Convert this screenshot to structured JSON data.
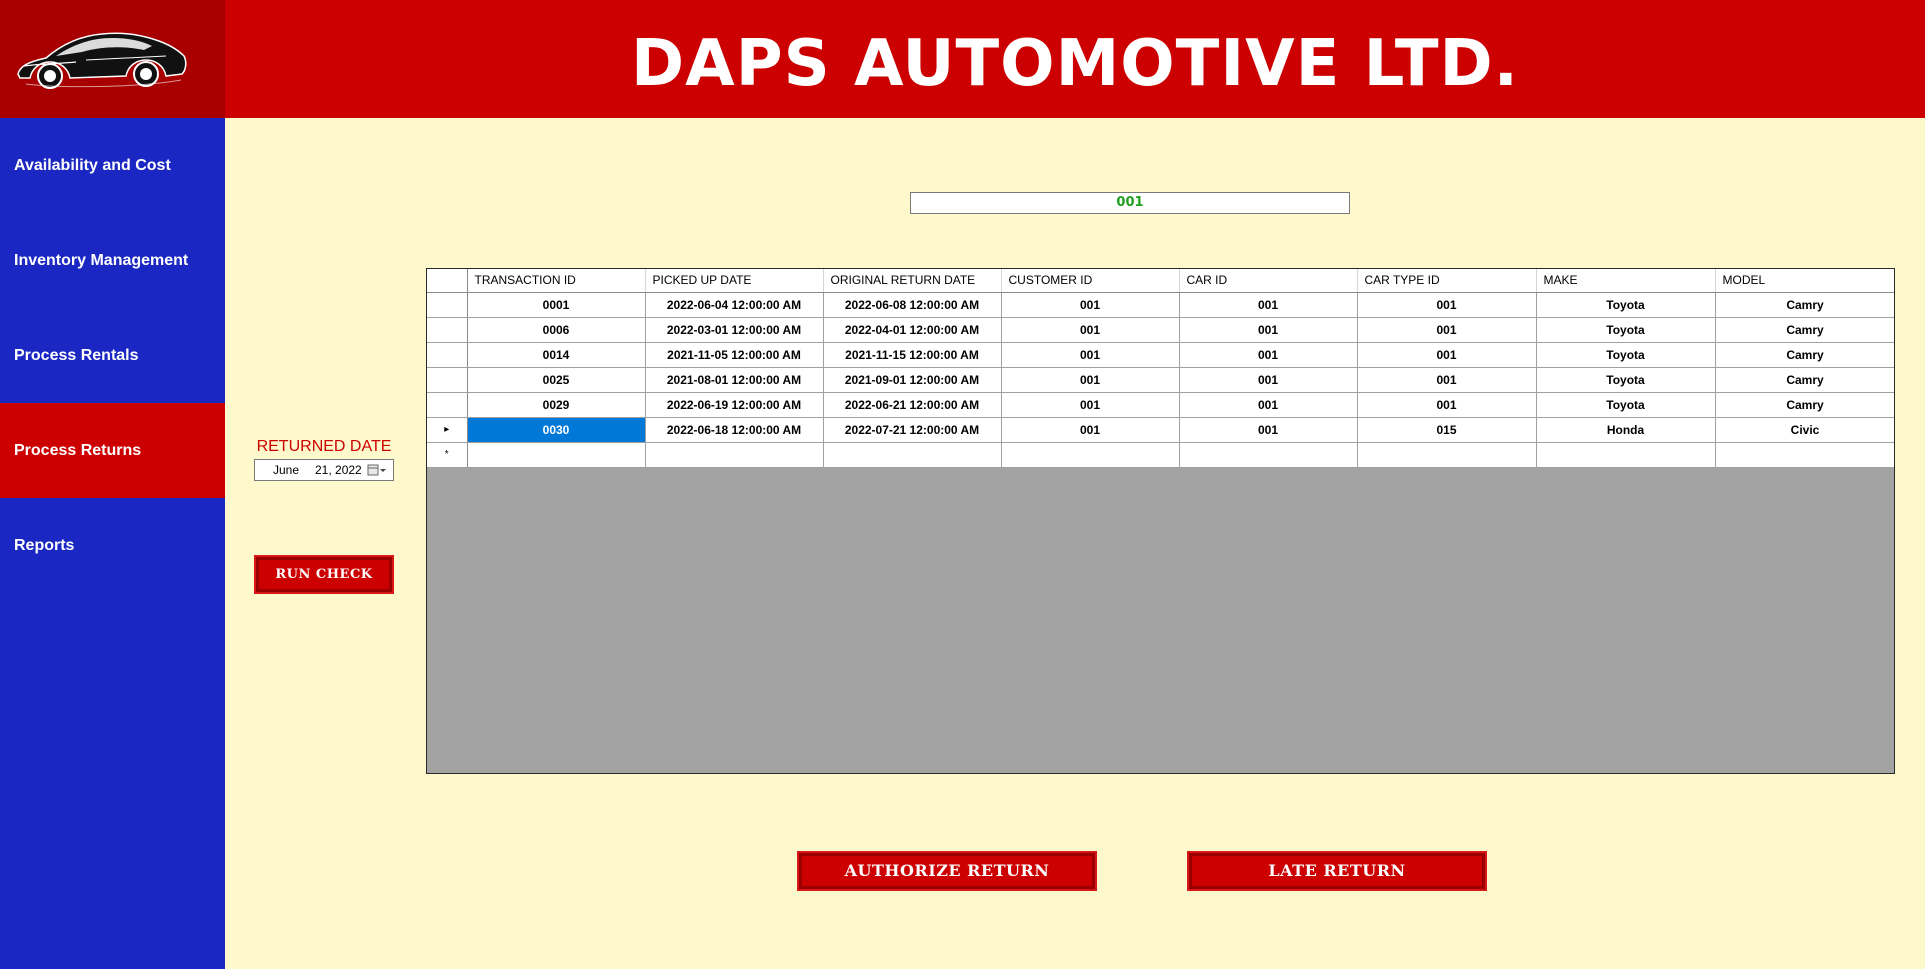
{
  "header": {
    "title": "DAPS AUTOMOTIVE LTD."
  },
  "sidebar": {
    "items": [
      {
        "label": "Availability and Cost",
        "active": false
      },
      {
        "label": "Inventory Management",
        "active": false
      },
      {
        "label": "Process Rentals",
        "active": false
      },
      {
        "label": "Process Returns",
        "active": true
      },
      {
        "label": "Reports",
        "active": false
      }
    ]
  },
  "customer_id_field": {
    "value": "001"
  },
  "returned_date": {
    "label": "RETURNED DATE",
    "month": "June",
    "day_year": "21, 2022"
  },
  "buttons": {
    "run_check": "RUN CHECK",
    "authorize_return": "AUTHORIZE RETURN",
    "late_return": "LATE RETURN"
  },
  "grid": {
    "columns": [
      "TRANSACTION ID",
      "PICKED UP DATE",
      "ORIGINAL RETURN DATE",
      "CUSTOMER ID",
      "CAR ID",
      "CAR TYPE ID",
      "MAKE",
      "MODEL"
    ],
    "rows": [
      [
        "0001",
        "2022-06-04 12:00:00 AM",
        "2022-06-08 12:00:00 AM",
        "001",
        "001",
        "001",
        "Toyota",
        "Camry"
      ],
      [
        "0006",
        "2022-03-01 12:00:00 AM",
        "2022-04-01 12:00:00 AM",
        "001",
        "001",
        "001",
        "Toyota",
        "Camry"
      ],
      [
        "0014",
        "2021-11-05 12:00:00 AM",
        "2021-11-15 12:00:00 AM",
        "001",
        "001",
        "001",
        "Toyota",
        "Camry"
      ],
      [
        "0025",
        "2021-08-01 12:00:00 AM",
        "2021-09-01 12:00:00 AM",
        "001",
        "001",
        "001",
        "Toyota",
        "Camry"
      ],
      [
        "0029",
        "2022-06-19 12:00:00 AM",
        "2022-06-21 12:00:00 AM",
        "001",
        "001",
        "001",
        "Toyota",
        "Camry"
      ],
      [
        "0030",
        "2022-06-18 12:00:00 AM",
        "2022-07-21 12:00:00 AM",
        "001",
        "001",
        "015",
        "Honda",
        "Civic"
      ]
    ],
    "current_row_marker": "▸",
    "new_row_marker": "*"
  },
  "colors": {
    "header_red": "#cc0000",
    "sidebar_blue": "#1a27c2",
    "background": "#fef9cc",
    "selection": "#0078d7"
  }
}
